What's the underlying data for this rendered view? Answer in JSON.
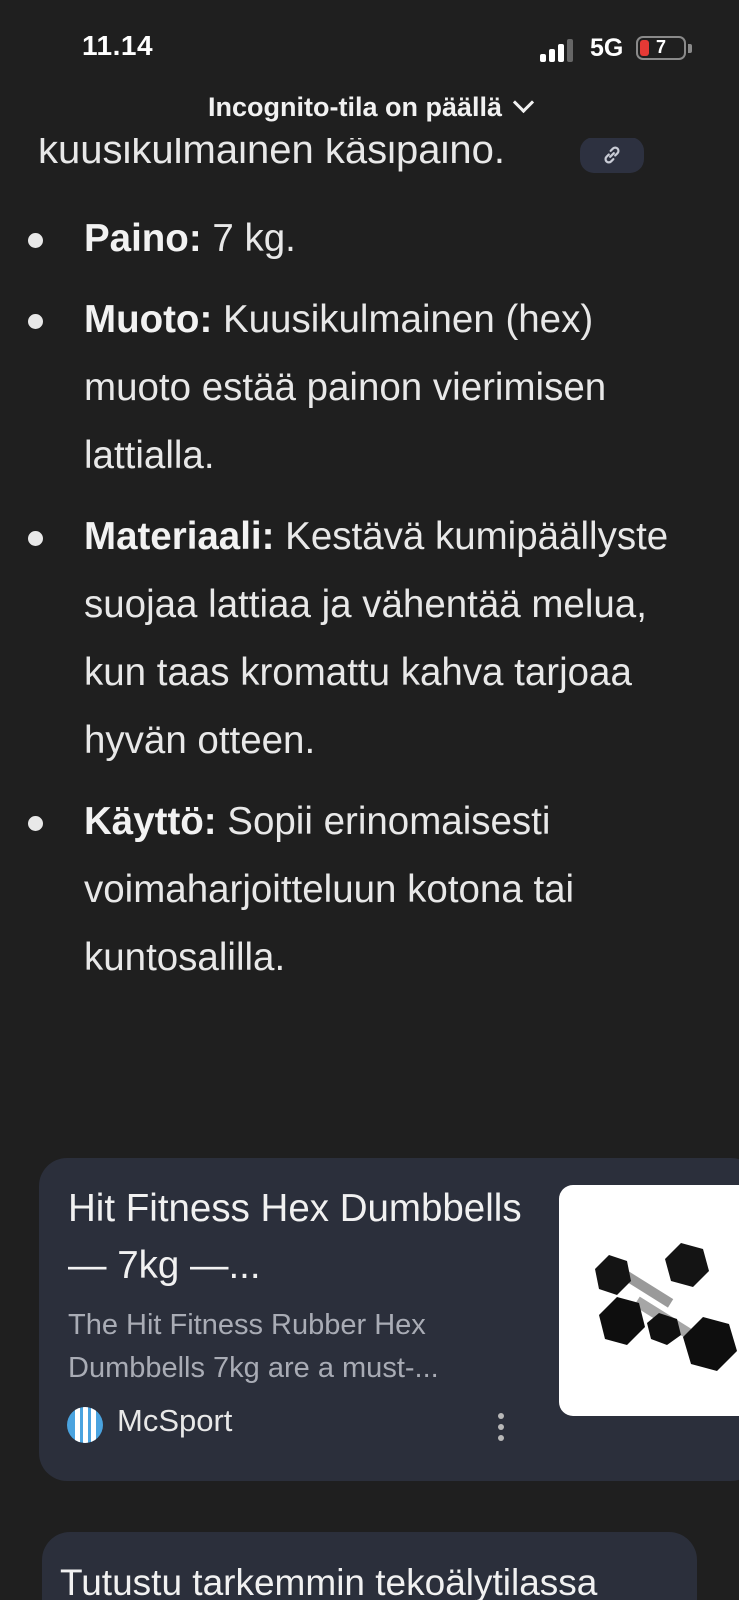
{
  "status_bar": {
    "time": "11.14",
    "network": "5G",
    "battery_level": "7",
    "battery_fraction": 0.07,
    "signal_bars_active": 3,
    "signal_bars_total": 4
  },
  "browser": {
    "incognito_label": "Incognito-tila on päällä"
  },
  "answer": {
    "partial_line": "kuusikulmainen käsipaino.",
    "bullets": [
      {
        "label": "Paino:",
        "text": " 7 kg."
      },
      {
        "label": "Muoto:",
        "text": " Kuusikulmainen (hex) muoto estää painon vierimisen lattialla."
      },
      {
        "label": "Materiaali:",
        "text": " Kestävä kumipäällyste suojaa lattiaa ja vähentää melua, kun taas kromattu kahva tarjoaa hyvän otteen."
      },
      {
        "label": "Käyttö:",
        "text": " Sopii erinomaisesti voimaharjoitteluun kotona tai kuntosalilla."
      }
    ]
  },
  "source_card": {
    "title": "Hit Fitness Hex Dumbbells — 7kg —...",
    "description": "The Hit Fitness Rubber Hex Dumbbells 7kg are a must-...",
    "source_name": "McSport"
  },
  "next_card": {
    "title": "Tutustu tarkemmin tekoälytilassa"
  },
  "icons": {
    "link": "link-icon",
    "more": "more-vert-icon",
    "chevron": "chevron-down-icon",
    "source_logo": "mcsport-logo",
    "accent_blue": "#4aa3df"
  }
}
